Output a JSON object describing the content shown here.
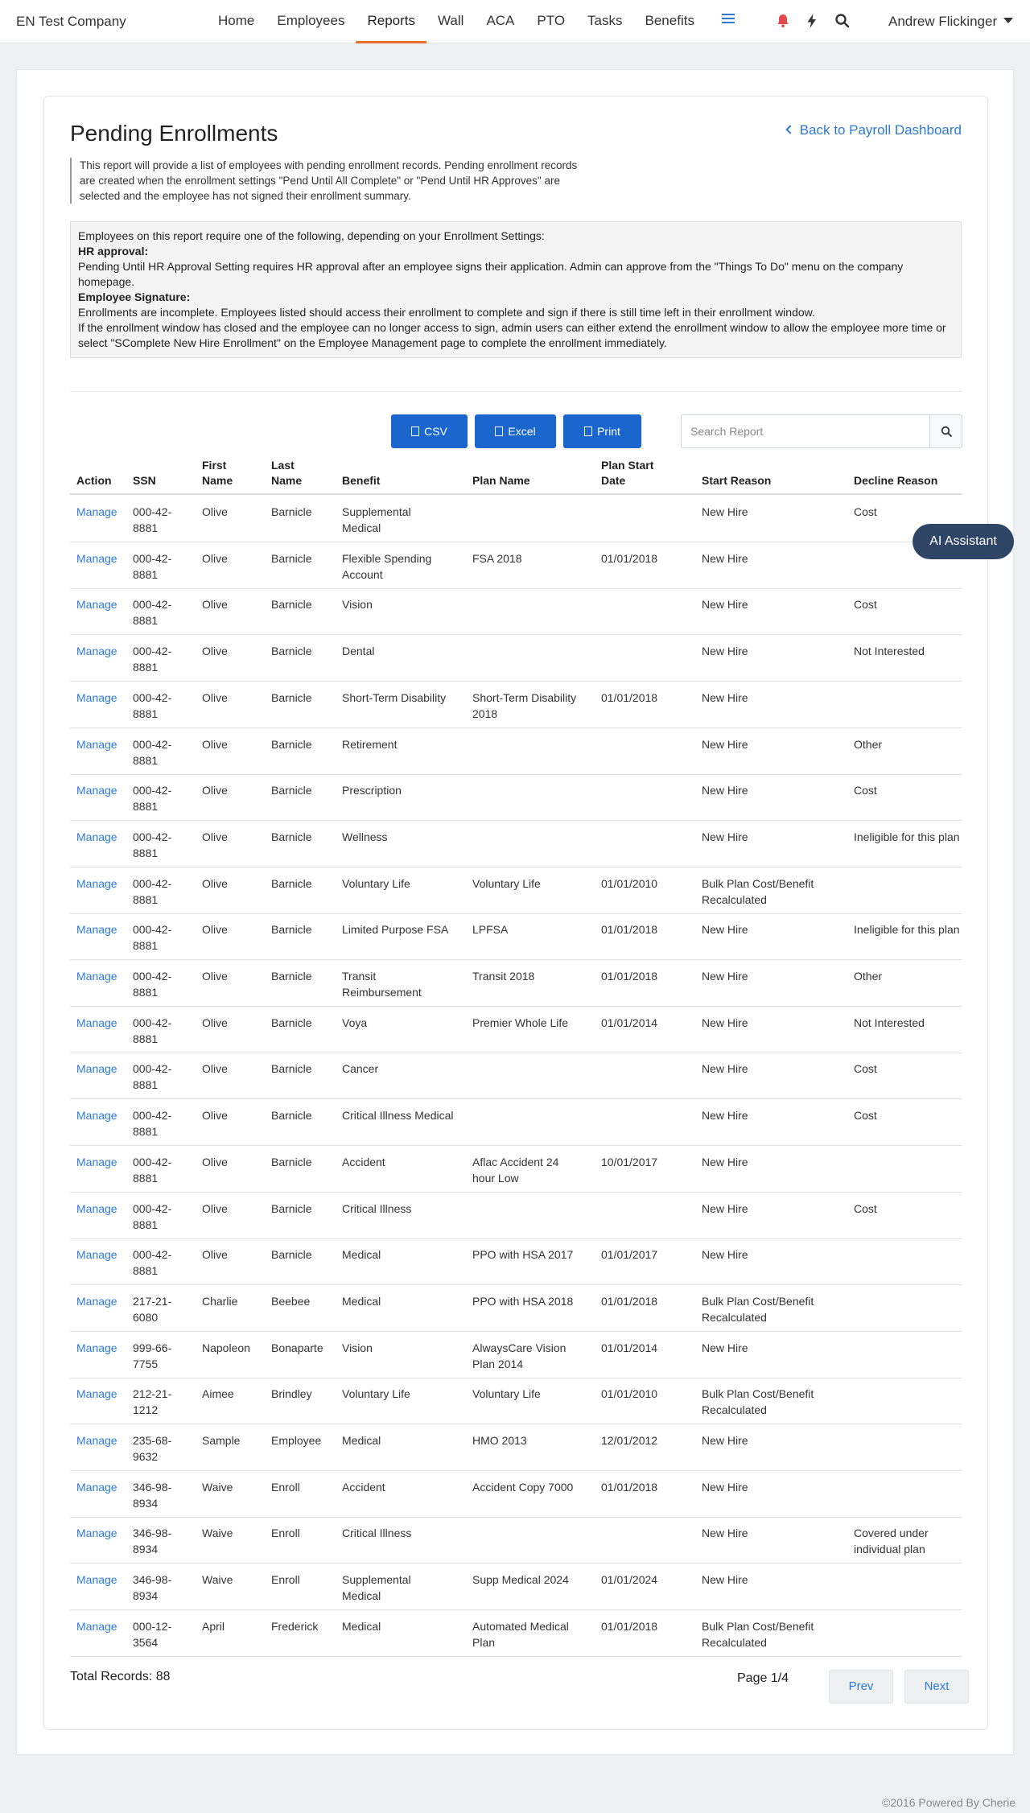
{
  "nav": {
    "brand": "EN Test Company",
    "links": [
      "Home",
      "Employees",
      "Reports",
      "Wall",
      "ACA",
      "PTO",
      "Tasks",
      "Benefits"
    ],
    "active": "Reports",
    "user": "Andrew Flickinger",
    "icons": [
      "hamburger-icon",
      "bell-icon",
      "bolt-icon",
      "search-icon"
    ]
  },
  "page": {
    "title": "Pending Enrollments",
    "back_link": "Back to Payroll Dashboard",
    "intro": "This report will provide a list of employees with pending enrollment records. Pending enrollment records are created when the enrollment settings \"Pend Until All Complete\" or \"Pend Until HR Approves\" are selected and the employee has not signed their enrollment summary.",
    "note_line1": "Employees on this report require one of the following, depending on your Enrollment Settings:",
    "note_hr_title": "HR approval:",
    "note_hr_text": "Pending Until HR Approval Setting requires HR approval after an employee signs their application. Admin can approve from the \"Things To Do\" menu on the company homepage.",
    "note_sig_title": "Employee Signature:",
    "note_sig_text1": "Enrollments are incomplete. Employees listed should access their enrollment to complete and sign if there is still time left in their enrollment window.",
    "note_sig_text2": "If the enrollment window has closed and the employee can no longer access to sign, admin users can either extend the enrollment window to allow the employee more time or select \"SComplete New Hire Enrollment\" on the Employee Management page to complete the enrollment immediately."
  },
  "toolbar": {
    "csv": "CSV",
    "excel": "Excel",
    "print": "Print",
    "search_placeholder": "Search Report"
  },
  "table": {
    "headers": [
      "Action",
      "SSN",
      "First\nName",
      "Last\nName",
      "Benefit",
      "Plan Name",
      "Plan Start\nDate",
      "Start Reason",
      "Decline Reason"
    ],
    "rows": [
      [
        "Manage",
        "000-42-\n8881",
        "Olive",
        "Barnicle",
        "Supplemental\nMedical",
        "",
        "",
        "New Hire",
        "Cost"
      ],
      [
        "Manage",
        "000-42-\n8881",
        "Olive",
        "Barnicle",
        "Flexible Spending\nAccount",
        "FSA 2018",
        "01/01/2018",
        "New Hire",
        ""
      ],
      [
        "Manage",
        "000-42-\n8881",
        "Olive",
        "Barnicle",
        "Vision",
        "",
        "",
        "New Hire",
        "Cost"
      ],
      [
        "Manage",
        "000-42-\n8881",
        "Olive",
        "Barnicle",
        "Dental",
        "",
        "",
        "New Hire",
        "Not Interested"
      ],
      [
        "Manage",
        "000-42-\n8881",
        "Olive",
        "Barnicle",
        "Short-Term Disability",
        "Short-Term Disability\n2018",
        "01/01/2018",
        "New Hire",
        ""
      ],
      [
        "Manage",
        "000-42-\n8881",
        "Olive",
        "Barnicle",
        "Retirement",
        "",
        "",
        "New Hire",
        "Other"
      ],
      [
        "Manage",
        "000-42-\n8881",
        "Olive",
        "Barnicle",
        "Prescription",
        "",
        "",
        "New Hire",
        "Cost"
      ],
      [
        "Manage",
        "000-42-\n8881",
        "Olive",
        "Barnicle",
        "Wellness",
        "",
        "",
        "New Hire",
        "Ineligible for this plan"
      ],
      [
        "Manage",
        "000-42-\n8881",
        "Olive",
        "Barnicle",
        "Voluntary Life",
        "Voluntary Life",
        "01/01/2010",
        "Bulk Plan Cost/Benefit\nRecalculated",
        ""
      ],
      [
        "Manage",
        "000-42-\n8881",
        "Olive",
        "Barnicle",
        "Limited Purpose FSA",
        "LPFSA",
        "01/01/2018",
        "New Hire",
        "Ineligible for this plan"
      ],
      [
        "Manage",
        "000-42-\n8881",
        "Olive",
        "Barnicle",
        "Transit\nReimbursement",
        "Transit 2018",
        "01/01/2018",
        "New Hire",
        "Other"
      ],
      [
        "Manage",
        "000-42-\n8881",
        "Olive",
        "Barnicle",
        "Voya",
        "Premier Whole Life",
        "01/01/2014",
        "New Hire",
        "Not Interested"
      ],
      [
        "Manage",
        "000-42-\n8881",
        "Olive",
        "Barnicle",
        "Cancer",
        "",
        "",
        "New Hire",
        "Cost"
      ],
      [
        "Manage",
        "000-42-\n8881",
        "Olive",
        "Barnicle",
        "Critical Illness Medical",
        "",
        "",
        "New Hire",
        "Cost"
      ],
      [
        "Manage",
        "000-42-\n8881",
        "Olive",
        "Barnicle",
        "Accident",
        "Aflac Accident 24\nhour Low",
        "10/01/2017",
        "New Hire",
        ""
      ],
      [
        "Manage",
        "000-42-\n8881",
        "Olive",
        "Barnicle",
        "Critical Illness",
        "",
        "",
        "New Hire",
        "Cost"
      ],
      [
        "Manage",
        "000-42-\n8881",
        "Olive",
        "Barnicle",
        "Medical",
        "PPO with HSA 2017",
        "01/01/2017",
        "New Hire",
        ""
      ],
      [
        "Manage",
        "217-21-\n6080",
        "Charlie",
        "Beebee",
        "Medical",
        "PPO with HSA 2018",
        "01/01/2018",
        "Bulk Plan Cost/Benefit\nRecalculated",
        ""
      ],
      [
        "Manage",
        "999-66-\n7755",
        "Napoleon",
        "Bonaparte",
        "Vision",
        "AlwaysCare Vision\nPlan 2014",
        "01/01/2014",
        "New Hire",
        ""
      ],
      [
        "Manage",
        "212-21-\n1212",
        "Aimee",
        "Brindley",
        "Voluntary Life",
        "Voluntary Life",
        "01/01/2010",
        "Bulk Plan Cost/Benefit\nRecalculated",
        ""
      ],
      [
        "Manage",
        "235-68-\n9632",
        "Sample",
        "Employee",
        "Medical",
        "HMO 2013",
        "12/01/2012",
        "New Hire",
        ""
      ],
      [
        "Manage",
        "346-98-\n8934",
        "Waive",
        "Enroll",
        "Accident",
        "Accident Copy 7000",
        "01/01/2018",
        "New Hire",
        ""
      ],
      [
        "Manage",
        "346-98-\n8934",
        "Waive",
        "Enroll",
        "Critical Illness",
        "",
        "",
        "New Hire",
        "Covered under\nindividual plan"
      ],
      [
        "Manage",
        "346-98-\n8934",
        "Waive",
        "Enroll",
        "Supplemental\nMedical",
        "Supp Medical 2024",
        "01/01/2024",
        "New Hire",
        ""
      ],
      [
        "Manage",
        "000-12-\n3564",
        "April",
        "Frederick",
        "Medical",
        "Automated Medical\nPlan",
        "01/01/2018",
        "Bulk Plan Cost/Benefit\nRecalculated",
        ""
      ]
    ]
  },
  "pagination": {
    "total": "Total Records: 88",
    "page": "Page 1/4",
    "prev": "Prev",
    "next": "Next"
  },
  "assistant": "AI Assistant",
  "footer": "©2016 Powered By Cherie"
}
